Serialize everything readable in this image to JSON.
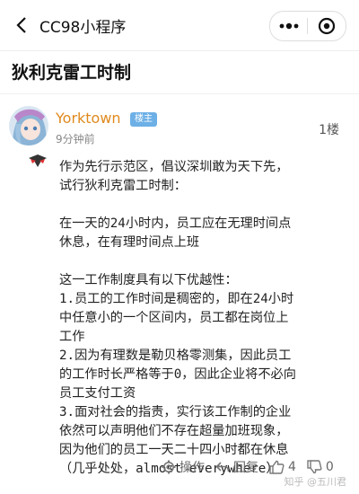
{
  "nav": {
    "title": "CC98小程序"
  },
  "post": {
    "title": "狄利克雷工时制",
    "author": "Yorktown",
    "badge": "楼主",
    "time": "9分钟前",
    "floor": "1楼",
    "content": "作为先行示范区，倡议深圳敢为天下先，\n试行狄利克雷工时制：\n\n在一天的24小时内，员工应在无理时间点\n休息，在有理时间点上班\n\n这一工作制度具有以下优越性：\n1.员工的工作时间是稠密的，即在24小时\n中任意小的一个区间内，员工都在岗位上\n工作\n2.因为有理数是勒贝格零测集，因此员工\n的工作时长严格等于0，因此企业将不必向\n员工支付工资\n3.面对社会的指责，实行该工作制的企业\n依然可以声明他们不存在超量加班现象，\n因为他们的员工一天二十四小时都在休息\n（几乎处处，almost everywhere）"
  },
  "actions": {
    "operate": "操作",
    "reply": "回复",
    "like_count": "4",
    "dislike_count": "0"
  },
  "watermark": "知乎 @五川君",
  "icons": {
    "back": "chevron-left-icon",
    "more": "more-dots-icon",
    "close": "target-close-icon",
    "operate": "gear-icon",
    "reply": "reply-arrow-icon",
    "like": "thumbs-up-icon",
    "dislike": "thumbs-down-icon"
  }
}
